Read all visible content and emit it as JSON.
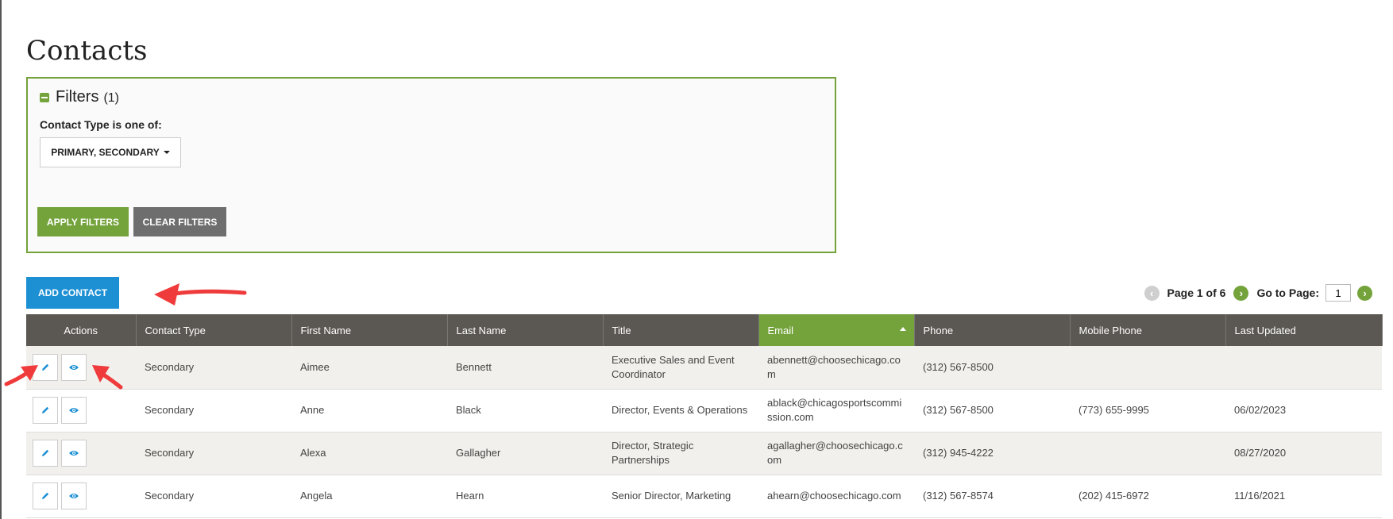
{
  "page": {
    "title": "Contacts"
  },
  "filters": {
    "title": "Filters",
    "count": "(1)",
    "contact_type_label": "Contact Type is one of:",
    "contact_type_value": "PRIMARY, SECONDARY",
    "apply_label": "APPLY FILTERS",
    "clear_label": "CLEAR FILTERS"
  },
  "toolbar": {
    "add_contact_label": "ADD CONTACT"
  },
  "pager": {
    "page_text": "Page 1 of 6",
    "goto_label": "Go to Page:",
    "current_page": "1"
  },
  "colors": {
    "accent_green": "#74a33b",
    "header_gray": "#5b5752",
    "add_blue": "#1d90d4",
    "arrow_red": "#ef3b3b"
  },
  "table": {
    "headers": [
      "Actions",
      "Contact Type",
      "First Name",
      "Last Name",
      "Title",
      "Email",
      "Phone",
      "Mobile Phone",
      "Last Updated"
    ],
    "rows": [
      [
        "Secondary",
        "Aimee",
        "Bennett",
        "Executive Sales and Event Coordinator",
        "abennett@choosechicago.com",
        "(312) 567-8500",
        "",
        ""
      ],
      [
        "Secondary",
        "Anne",
        "Black",
        "Director, Events & Operations",
        "ablack@chicagosportscommission.com",
        "(312) 567-8500",
        "(773) 655-9995",
        "06/02/2023"
      ],
      [
        "Secondary",
        "Alexa",
        "Gallagher",
        "Director, Strategic Partnerships",
        "agallagher@choosechicago.com",
        "(312) 945-4222",
        "",
        "08/27/2020"
      ],
      [
        "Secondary",
        "Angela",
        "Hearn",
        "Senior Director, Marketing",
        "ahearn@choosechicago.com",
        "(312) 567-8574",
        "(202) 415-6972",
        "11/16/2021"
      ]
    ]
  }
}
